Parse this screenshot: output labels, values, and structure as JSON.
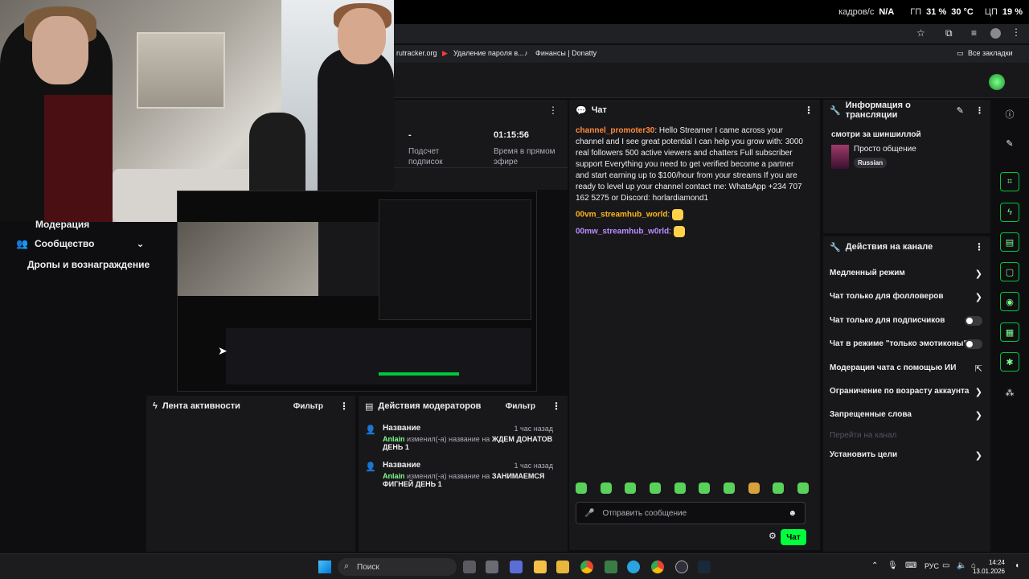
{
  "overlay": {
    "fps_label": "кадров/с",
    "fps_value": "N/A",
    "gpu_label": "ГП",
    "gpu_percent": "31 %",
    "gpu_temp": "30 °C",
    "cpu_label": "ЦП",
    "cpu_percent": "19 %"
  },
  "bookmarks": {
    "items": [
      "rutracker.org",
      "Удаление пароля в...",
      "Финансы | Donatty"
    ],
    "all": "Все закладки"
  },
  "leftnav": {
    "items": [
      "Модерация",
      "Сообщество",
      "Дропы и вознаграждение"
    ]
  },
  "stats": {
    "subs_value": "-",
    "subs_label": "Подсчет подписок",
    "uptime_value": "01:15:56",
    "uptime_label": "Время в прямом эфире"
  },
  "chat": {
    "title": "Чат",
    "messages": [
      {
        "user": "channel_promoter30",
        "text": ": Hello Streamer I came across your channel and I see great potential I can help you grow with: 3000 real followers 500 active viewers and chatters Full subscriber support Everything you need to get verified become a partner and start earning up to $100/hour from your streams If you are ready to level up your channel contact me: WhatsApp +234 707 162 5275 or Discord: horlardiamond1"
      },
      {
        "user": "00vm_streamhub_world",
        "text": ":"
      },
      {
        "user": "00mw_streamhub_w0rld",
        "text": ":"
      }
    ],
    "input_placeholder": "Отправить сообщение",
    "send_label": "Чат"
  },
  "stream_info": {
    "title": "Информация о трансляции",
    "stream_title": "смотри за шиншиллой",
    "category": "Просто общение",
    "language": "Russian"
  },
  "channel_actions": {
    "title": "Действия на канале",
    "rows": [
      {
        "label": "Медленный режим",
        "control": "chevron"
      },
      {
        "label": "Чат только для фолловеров",
        "control": "chevron"
      },
      {
        "label": "Чат только для подписчиков",
        "control": "toggle"
      },
      {
        "label": "Чат в режиме \"только эмотиконы\"",
        "control": "toggle"
      },
      {
        "label": "Модерация чата с помощью ИИ",
        "control": "external"
      },
      {
        "label": "Ограничение по возрасту аккаунта",
        "control": "chevron"
      },
      {
        "label": "Запрещенные слова",
        "control": "chevron"
      },
      {
        "label": "Перейти на канал",
        "control": "none"
      },
      {
        "label": "Установить цели",
        "control": "chevron"
      }
    ]
  },
  "activity_feed": {
    "title": "Лента активности",
    "filter": "Фильтр"
  },
  "mod_actions": {
    "title": "Действия модераторов",
    "filter": "Фильтр",
    "entries": [
      {
        "title": "Название",
        "time": "1 час назад",
        "user": "Anlain",
        "action": "изменил(-а) название на",
        "value": "ЖДЕМ ДОНАТОВ ДЕНЬ 1"
      },
      {
        "title": "Название",
        "time": "1 час назад",
        "user": "Anlain",
        "action": "изменил(-а) название на",
        "value": "ЗАНИМАЕМСЯ ФИГНЕЙ ДЕНЬ 1"
      }
    ]
  },
  "taskbar": {
    "search": "Поиск",
    "lang": "РУС",
    "time": "14:24",
    "date": "13.01.2026"
  },
  "colors": {
    "accent": "#00ff3c",
    "bg": "#0e0e10",
    "panel": "#18181b"
  }
}
